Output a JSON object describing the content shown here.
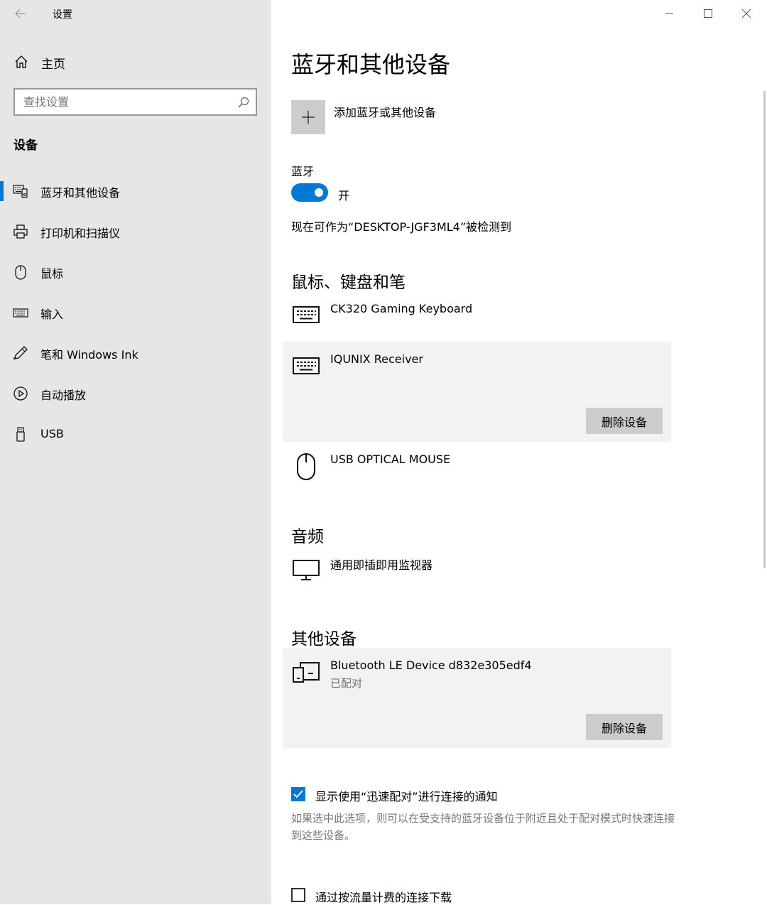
{
  "window": {
    "app_title": "设置",
    "controls": [
      "minimize",
      "maximize",
      "close"
    ]
  },
  "sidebar": {
    "home_label": "主页",
    "search_placeholder": "查找设置",
    "section_header": "设备",
    "items": [
      {
        "label": "蓝牙和其他设备",
        "icon": "bluetooth-devices-icon",
        "selected": true
      },
      {
        "label": "打印机和扫描仪",
        "icon": "printer-icon",
        "selected": false
      },
      {
        "label": "鼠标",
        "icon": "mouse-icon",
        "selected": false
      },
      {
        "label": "输入",
        "icon": "keyboard-icon",
        "selected": false
      },
      {
        "label": "笔和 Windows Ink",
        "icon": "pen-icon",
        "selected": false
      },
      {
        "label": "自动播放",
        "icon": "autoplay-icon",
        "selected": false
      },
      {
        "label": "USB",
        "icon": "usb-icon",
        "selected": false
      }
    ]
  },
  "main": {
    "title": "蓝牙和其他设备",
    "add_device_label": "添加蓝牙或其他设备",
    "bluetooth": {
      "label": "蓝牙",
      "toggle_on": true,
      "toggle_state_label": "开",
      "discoverable_text": "现在可作为“DESKTOP-JGF3ML4”被检测到"
    },
    "groups": {
      "input": {
        "title": "鼠标、键盘和笔",
        "devices": [
          {
            "name": "CK320 Gaming Keyboard",
            "icon": "keyboard-icon"
          },
          {
            "name": "IQUNIX Receiver",
            "icon": "keyboard-icon",
            "selected": true,
            "remove_label": "删除设备"
          },
          {
            "name": "USB OPTICAL MOUSE",
            "icon": "mouse-icon"
          }
        ]
      },
      "audio": {
        "title": "音频",
        "devices": [
          {
            "name": "通用即插即用监视器",
            "icon": "monitor-icon"
          }
        ]
      },
      "other": {
        "title": "其他设备",
        "devices": [
          {
            "name": "Bluetooth LE Device d832e305edf4",
            "status": "已配对",
            "icon": "generic-device-icon",
            "selected": true,
            "remove_label": "删除设备"
          }
        ]
      }
    },
    "swift_pair": {
      "checked": true,
      "label": "显示使用“迅速配对”进行连接的通知",
      "description": "如果选中此选项，则可以在受支持的蓝牙设备位于附近且处于配对模式时快速连接到这些设备。"
    },
    "metered": {
      "checked": false,
      "label": "通过按流量计费的连接下载"
    }
  },
  "colors": {
    "accent": "#0078d7",
    "sidebar_bg": "#e6e6e6",
    "selected_row_bg": "#f2f2f2",
    "button_bg": "#cccccc"
  }
}
